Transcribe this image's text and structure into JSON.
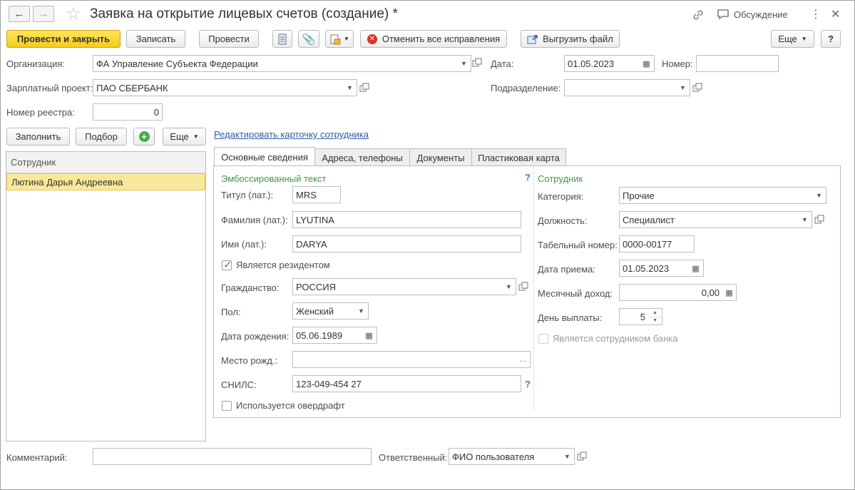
{
  "window": {
    "title": "Заявка на открытие лицевых счетов (создание) *",
    "discussion_label": "Обсуждение"
  },
  "toolbar": {
    "post_close": "Провести и закрыть",
    "save": "Записать",
    "post": "Провести",
    "cancel_corrections": "Отменить все исправления",
    "export_file": "Выгрузить файл",
    "more": "Еще",
    "help": "?"
  },
  "header": {
    "organization_label": "Организация:",
    "organization_value": "ФА Управление Субъекта Федерации",
    "date_label": "Дата:",
    "date_value": "01.05.2023",
    "number_label": "Номер:",
    "number_value": "",
    "salary_project_label": "Зарплатный проект:",
    "salary_project_value": "ПАО СБЕРБАНК",
    "division_label": "Подразделение:",
    "division_value": "",
    "registry_number_label": "Номер реестра:",
    "registry_number_value": "0"
  },
  "list_toolbar": {
    "fill": "Заполнить",
    "select": "Подбор",
    "more": "Еще",
    "edit_card_link": "Редактировать карточку сотрудника"
  },
  "employee_list": {
    "column_header": "Сотрудник",
    "rows": [
      "Лютина Дарья Андреевна"
    ]
  },
  "tabs": [
    "Основные сведения",
    "Адреса, телефоны",
    "Документы",
    "Пластиковая карта"
  ],
  "embossed": {
    "section_title": "Эмбоссированный текст",
    "help": "?",
    "title_label": "Титул (лат.):",
    "title_value": "MRS",
    "surname_label": "Фамилия (лат.):",
    "surname_value": "LYUTINA",
    "name_label": "Имя (лат.):",
    "name_value": "DARYA",
    "resident_label": "Является резидентом",
    "citizenship_label": "Гражданство:",
    "citizenship_value": "РОССИЯ",
    "gender_label": "Пол:",
    "gender_value": "Женский",
    "birth_date_label": "Дата рождения:",
    "birth_date_value": "05.06.1989",
    "birth_place_label": "Место рожд.:",
    "birth_place_value": "",
    "snils_label": "СНИЛС:",
    "snils_value": "123-049-454 27",
    "snils_help": "?",
    "overdraft_label": "Используется овердрафт"
  },
  "employee": {
    "section_title": "Сотрудник",
    "category_label": "Категория:",
    "category_value": "Прочие",
    "position_label": "Должность:",
    "position_value": "Специалист",
    "tab_number_label": "Табельный номер:",
    "tab_number_value": "0000-00177",
    "hire_date_label": "Дата приема:",
    "hire_date_value": "01.05.2023",
    "monthly_income_label": "Месячный доход:",
    "monthly_income_value": "0,00",
    "payday_label": "День выплаты:",
    "payday_value": "5",
    "bank_employee_label": "Является сотрудником банка"
  },
  "footer": {
    "comment_label": "Комментарий:",
    "comment_value": "",
    "responsible_label": "Ответственный:",
    "responsible_value": "ФИО пользователя"
  },
  "colors": {
    "primary_button": "#f4cc1c",
    "section_title": "#3c9a47",
    "selected_row": "#fae89a",
    "link": "#2b5ea8"
  }
}
